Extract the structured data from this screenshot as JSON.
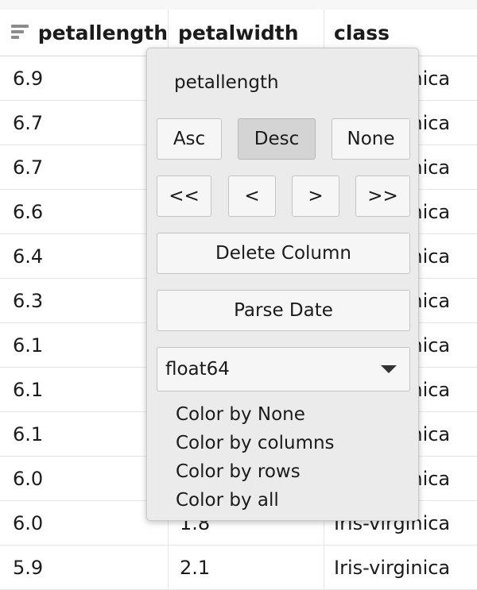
{
  "table": {
    "columns": [
      "petallength",
      "petalwidth",
      "class"
    ],
    "rows": [
      [
        "6.9",
        "",
        "Iris-virginica"
      ],
      [
        "6.7",
        "",
        "Iris-virginica"
      ],
      [
        "6.7",
        "",
        "Iris-virginica"
      ],
      [
        "6.6",
        "",
        "Iris-virginica"
      ],
      [
        "6.4",
        "",
        "Iris-virginica"
      ],
      [
        "6.3",
        "",
        "Iris-virginica"
      ],
      [
        "6.1",
        "",
        "Iris-virginica"
      ],
      [
        "6.1",
        "",
        "Iris-virginica"
      ],
      [
        "6.1",
        "",
        "Iris-virginica"
      ],
      [
        "6.0",
        "",
        "Iris-virginica"
      ],
      [
        "6.0",
        "1.8",
        "Iris-virginica"
      ],
      [
        "5.9",
        "2.1",
        "Iris-virginica"
      ]
    ]
  },
  "popup": {
    "title": "petallength",
    "sort": {
      "asc": "Asc",
      "desc": "Desc",
      "none": "None",
      "active": "Desc"
    },
    "move": {
      "first": "<<",
      "prev": "<",
      "next": ">",
      "last": ">>"
    },
    "delete_label": "Delete Column",
    "parse_date_label": "Parse Date",
    "dtype_selected": "float64",
    "color_options": [
      "Color by None",
      "Color by columns",
      "Color by rows",
      "Color by all"
    ]
  }
}
